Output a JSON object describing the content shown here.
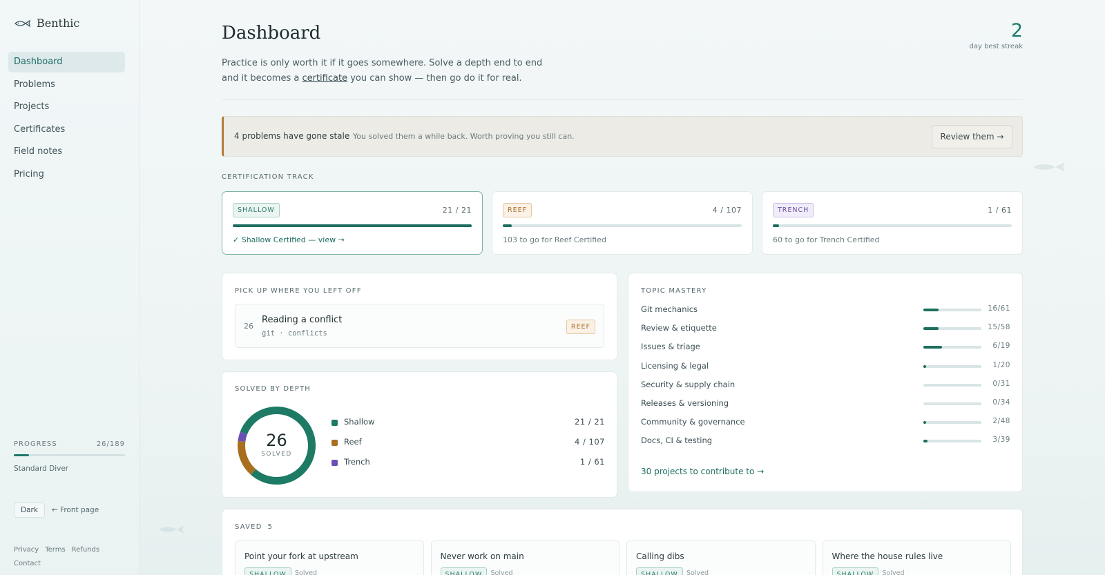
{
  "app": {
    "name": "Benthic"
  },
  "sidebar": {
    "items": [
      {
        "label": "Dashboard",
        "active": true
      },
      {
        "label": "Problems"
      },
      {
        "label": "Projects"
      },
      {
        "label": "Certificates"
      },
      {
        "label": "Field notes"
      },
      {
        "label": "Pricing"
      }
    ],
    "progress": {
      "label": "PROGRESS",
      "value": "26/189",
      "fraction": 0.1376,
      "rank": "Standard Diver"
    },
    "dark_label": "Dark",
    "front_page_label": "← Front page",
    "footer": [
      "Privacy",
      "Terms",
      "Refunds",
      "Contact"
    ]
  },
  "header": {
    "title": "Dashboard",
    "intro_before": "Practice is only worth it if it goes somewhere. Solve a depth end to end and it becomes a ",
    "intro_link": "certificate",
    "intro_after": " you can show — then go do it for real.",
    "streak_value": "2",
    "streak_label": "day best streak"
  },
  "stale_banner": {
    "title": "4 problems have gone stale",
    "subtitle": "You solved them a while back. Worth proving you still can.",
    "button": "Review them →"
  },
  "certification": {
    "label": "CERTIFICATION TRACK",
    "tracks": [
      {
        "chip": "SHALLOW",
        "count": "21  /  21",
        "fraction": 1.0,
        "note": "✓ Shallow Certified — view →"
      },
      {
        "chip": "REEF",
        "count": "4  /  107",
        "fraction": 0.037,
        "note": "103 to go for Reef Certified"
      },
      {
        "chip": "TRENCH",
        "count": "1  /  61",
        "fraction": 0.016,
        "note": "60 to go for Trench Certified"
      }
    ]
  },
  "pickup": {
    "label": "PICK UP WHERE YOU LEFT OFF",
    "number": "26",
    "title": "Reading a conflict",
    "tags": "git · conflicts",
    "chip": "REEF"
  },
  "solved": {
    "label": "SOLVED BY DEPTH",
    "total": "26",
    "total_label": "SOLVED",
    "rows": [
      {
        "name": "Shallow",
        "value": "21  /  21",
        "count": 21,
        "color": "#1d7a64"
      },
      {
        "name": "Reef",
        "value": "4  /  107",
        "count": 4,
        "color": "#a86f1f"
      },
      {
        "name": "Trench",
        "value": "1  /  61",
        "count": 1,
        "color": "#6b4fb5"
      }
    ]
  },
  "mastery": {
    "label": "TOPIC MASTERY",
    "topics": [
      {
        "name": "Git mechanics",
        "value": "16/61",
        "fraction": 0.262
      },
      {
        "name": "Review & etiquette",
        "value": "15/58",
        "fraction": 0.259
      },
      {
        "name": "Issues & triage",
        "value": "6/19",
        "fraction": 0.316
      },
      {
        "name": "Licensing & legal",
        "value": "1/20",
        "fraction": 0.05
      },
      {
        "name": "Security & supply chain",
        "value": "0/31",
        "fraction": 0
      },
      {
        "name": "Releases & versioning",
        "value": "0/34",
        "fraction": 0
      },
      {
        "name": "Community & governance",
        "value": "2/48",
        "fraction": 0.042
      },
      {
        "name": "Docs, CI & testing",
        "value": "3/39",
        "fraction": 0.077
      }
    ],
    "link": "30 projects to contribute to →"
  },
  "saved": {
    "label": "SAVED",
    "count": "5",
    "items": [
      {
        "title": "Point your fork at upstream",
        "chip": "SHALLOW",
        "status": "Solved"
      },
      {
        "title": "Never work on main",
        "chip": "SHALLOW",
        "status": "Solved"
      },
      {
        "title": "Calling dibs",
        "chip": "SHALLOW",
        "status": "Solved"
      },
      {
        "title": "Where the house rules live",
        "chip": "SHALLOW",
        "status": "Solved"
      }
    ]
  }
}
